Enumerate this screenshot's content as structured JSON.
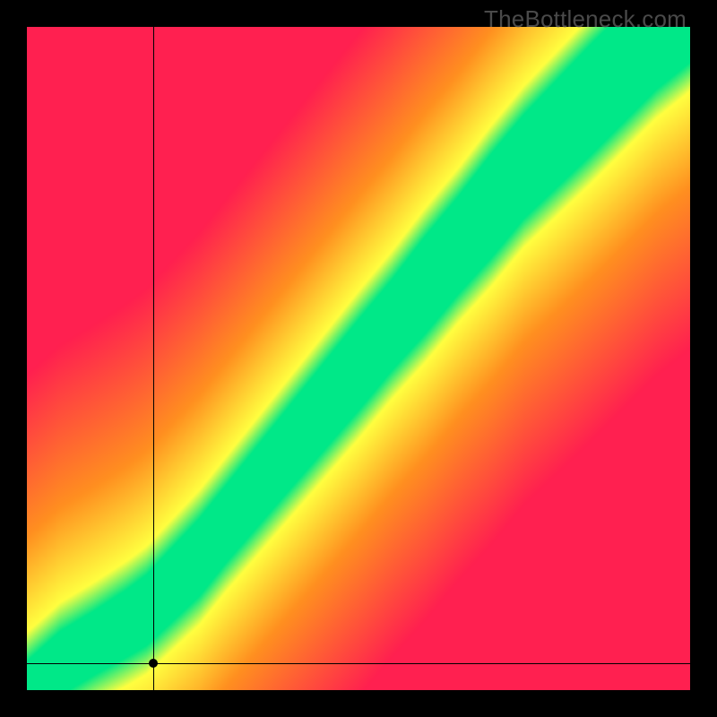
{
  "watermark": "TheBottleneck.com",
  "chart_data": {
    "type": "heatmap",
    "title": "",
    "xlabel": "",
    "ylabel": "",
    "xlim": [
      0,
      100
    ],
    "ylim": [
      0,
      100
    ],
    "marker": {
      "x": 19,
      "y": 4
    },
    "crosshair": {
      "x": 19,
      "y": 4
    },
    "optimal_band": [
      {
        "x": 0,
        "center": 0,
        "width": 2
      },
      {
        "x": 5,
        "center": 4,
        "width": 3
      },
      {
        "x": 10,
        "center": 7,
        "width": 3
      },
      {
        "x": 15,
        "center": 10,
        "width": 3.5
      },
      {
        "x": 18,
        "center": 12,
        "width": 4
      },
      {
        "x": 22,
        "center": 16,
        "width": 4.5
      },
      {
        "x": 26,
        "center": 20,
        "width": 5
      },
      {
        "x": 30,
        "center": 25,
        "width": 5
      },
      {
        "x": 35,
        "center": 31,
        "width": 5.5
      },
      {
        "x": 40,
        "center": 37,
        "width": 6
      },
      {
        "x": 45,
        "center": 43,
        "width": 6.5
      },
      {
        "x": 50,
        "center": 49,
        "width": 7
      },
      {
        "x": 55,
        "center": 55,
        "width": 7
      },
      {
        "x": 60,
        "center": 61,
        "width": 8
      },
      {
        "x": 65,
        "center": 67,
        "width": 8
      },
      {
        "x": 70,
        "center": 73,
        "width": 9
      },
      {
        "x": 75,
        "center": 79,
        "width": 9
      },
      {
        "x": 80,
        "center": 84,
        "width": 9.5
      },
      {
        "x": 85,
        "center": 89,
        "width": 10
      },
      {
        "x": 90,
        "center": 94,
        "width": 10
      },
      {
        "x": 95,
        "center": 99,
        "width": 10
      },
      {
        "x": 100,
        "center": 103,
        "width": 10
      }
    ],
    "color_stops": {
      "optimal": "#00e888",
      "near": "#ffff40",
      "mid": "#ff9020",
      "far": "#ff2050"
    }
  }
}
